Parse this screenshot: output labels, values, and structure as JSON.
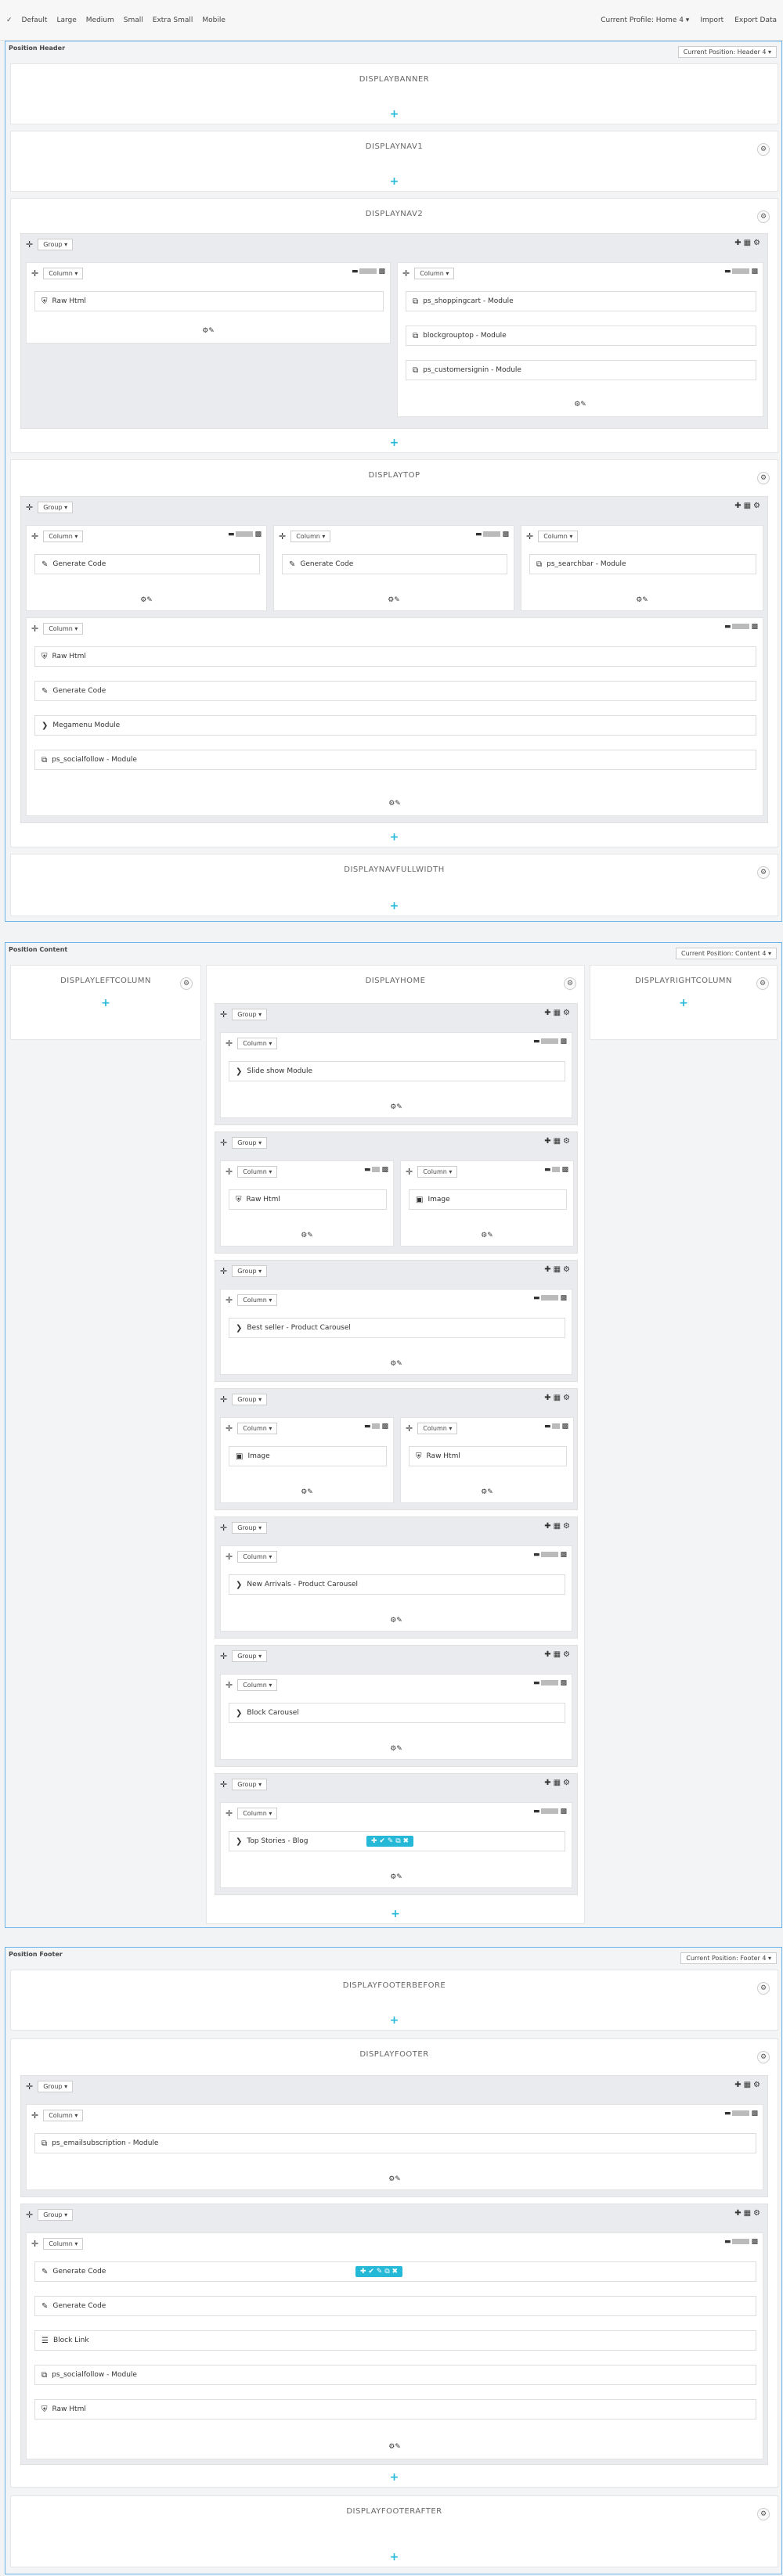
{
  "toolbar": {
    "icon": "✓",
    "devices": [
      "Default",
      "Large",
      "Medium",
      "Small",
      "Extra Small",
      "Mobile"
    ],
    "profile": "Current Profile: Home 4 ▾",
    "import": "Import",
    "export": "Export Data"
  },
  "sections": {
    "header": {
      "title": "Position Header",
      "select": "Current Position: Header 4 ▾"
    },
    "content": {
      "title": "Position Content",
      "select": "Current Position: Content 4 ▾"
    },
    "footer": {
      "title": "Position Footer",
      "select": "Current Position: Footer 4 ▾"
    }
  },
  "hooks": {
    "banner": "DISPLAYBANNER",
    "nav1": "DISPLAYNAV1",
    "nav2": "DISPLAYNAV2",
    "top": "DISPLAYTOP",
    "navfull": "DISPLAYNAVFULLWIDTH",
    "left": "DISPLAYLEFTCOLUMN",
    "home": "DISPLAYHOME",
    "right": "DISPLAYRIGHTCOLUMN",
    "footerbefore": "DISPLAYFOOTERBEFORE",
    "footer": "DISPLAYFOOTER",
    "footerafter": "DISPLAYFOOTERAFTER"
  },
  "labels": {
    "group": "Group ▾",
    "column": "Column ▾",
    "gear": "⚙",
    "plus": "+",
    "move": "✛",
    "gtools": "✚▦⚙",
    "cfoot": "⚙✎",
    "quick": "✚ ✔ ✎ ⧉ ✖"
  },
  "modules": {
    "rawhtml": "Raw Html",
    "shoppingcart": "ps_shoppingcart - Module",
    "blockgrouptop": "blockgrouptop - Module",
    "customersignin": "ps_customersignin - Module",
    "generatecode": "Generate Code",
    "searchbar": "ps_searchbar - Module",
    "megamenu": "Megamenu Module",
    "socialfollow": "ps_socialfollow - Module",
    "slideshow": "Slide show Module",
    "image": "Image",
    "bestseller": "Best seller - Product Carousel",
    "newarrivals": "New Arrivals - Product Carousel",
    "blockcarousel": "Block Carousel",
    "topstories": "Top Stories - Blog",
    "emailsub": "ps_emailsubscription - Module",
    "blocklink": "Block Link"
  },
  "icons": {
    "html": "⛨",
    "module": "⧉",
    "code": "✎",
    "chevron": "❯",
    "image": "▣",
    "list": "☰"
  }
}
